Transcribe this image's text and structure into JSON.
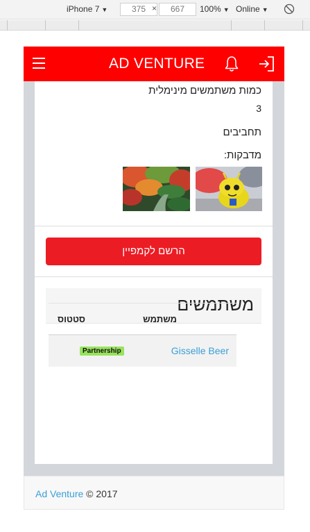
{
  "devtools": {
    "device": "iPhone 7",
    "width": "375",
    "height": "667",
    "times": "×",
    "zoom": "100%",
    "network": "Online"
  },
  "navbar": {
    "brand": "AD VENTURE",
    "accent": "#ff0000"
  },
  "campaign": {
    "min_users_label": "כמות משתמשים מינימלית",
    "min_users_value": "3",
    "hobbies_label": "תחביבים",
    "stickers_label": "מדבקות:",
    "stickers": [
      {
        "name": "android-figure"
      },
      {
        "name": "autumn-garden"
      }
    ],
    "register_label": "הרשם לקמפיין",
    "register_color": "#ec1c24"
  },
  "users": {
    "title": "משתמשים",
    "columns": {
      "user": "משתמש",
      "status": "סטטוס"
    },
    "rows": [
      {
        "name": "Gisselle Beer",
        "status": "Partnership",
        "status_color": "#98e35d"
      }
    ]
  },
  "footer": {
    "brand_link": "Ad Venture",
    "copyright": "© 2017"
  }
}
